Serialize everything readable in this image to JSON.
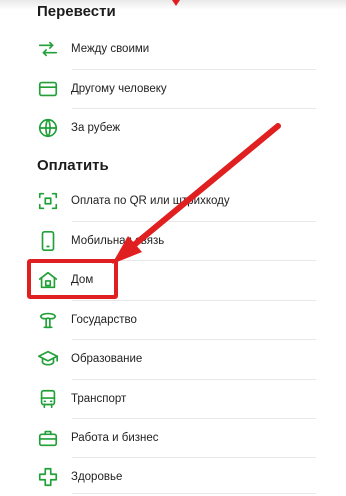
{
  "sections": {
    "transfer": {
      "title": "Перевести"
    },
    "pay": {
      "title": "Оплатить"
    }
  },
  "transfer_items": [
    {
      "label": "Между своими",
      "icon": "transfer-arrows-icon"
    },
    {
      "label": "Другому человеку",
      "icon": "card-icon"
    },
    {
      "label": "За рубеж",
      "icon": "globe-icon"
    }
  ],
  "pay_items": [
    {
      "label": "Оплата по QR или штрихкоду",
      "icon": "qr-scan-icon"
    },
    {
      "label": "Мобильная связь",
      "icon": "phone-icon"
    },
    {
      "label": "Дом",
      "icon": "home-icon"
    },
    {
      "label": "Государство",
      "icon": "government-icon"
    },
    {
      "label": "Образование",
      "icon": "graduation-cap-icon"
    },
    {
      "label": "Транспорт",
      "icon": "bus-icon"
    },
    {
      "label": "Работа и бизнес",
      "icon": "briefcase-icon"
    },
    {
      "label": "Здоровье",
      "icon": "health-cross-icon"
    }
  ],
  "colors": {
    "accent": "#21a038",
    "annotation": "#e02020"
  }
}
